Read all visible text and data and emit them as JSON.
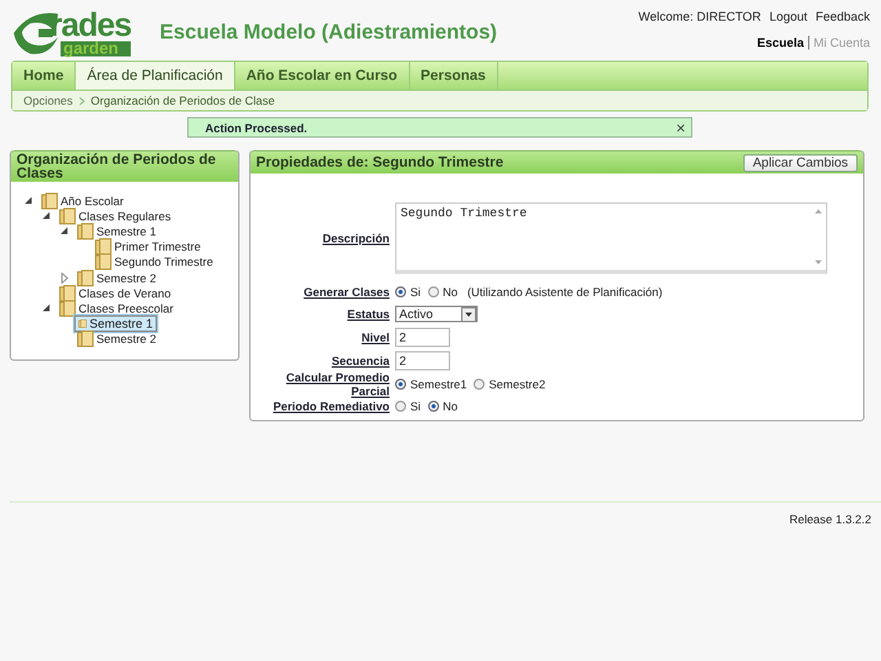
{
  "logo": {
    "word": "rades",
    "sub": "garden"
  },
  "school": "Escuela Modelo (Adiestramientos)",
  "user_links": [
    "Welcome: DIRECTOR",
    "Logout",
    "Feedback"
  ],
  "context_links": [
    {
      "label": "Escuela",
      "selected": true
    },
    {
      "label": "Mi Cuenta",
      "selected": false
    }
  ],
  "tabs": [
    {
      "label": "Home",
      "selected": false
    },
    {
      "label": "Área de Planificación",
      "selected": true
    },
    {
      "label": "Año Escolar en Curso",
      "selected": false
    },
    {
      "label": "Personas",
      "selected": false
    }
  ],
  "breadcrumb": [
    "Opciones",
    "Organización de Periodos de Clase"
  ],
  "message": {
    "text": "Action Processed.",
    "close": "×"
  },
  "tree_panel": {
    "title": "Organización de Periodos de Clases",
    "items": [
      {
        "label": "Año Escolar",
        "expanded": true,
        "selected": false,
        "children": [
          {
            "label": "Clases Regulares",
            "expanded": true,
            "selected": false,
            "children": [
              {
                "label": "Semestre 1",
                "expanded": true,
                "selected": false,
                "children": [
                  {
                    "label": "Primer Trimestre",
                    "selected": false
                  },
                  {
                    "label": "Segundo Trimestre",
                    "selected": false
                  }
                ]
              },
              {
                "label": "Semestre 2",
                "expanded": false,
                "selected": false
              }
            ]
          },
          {
            "label": "Clases de Verano",
            "selected": false
          },
          {
            "label": "Clases Preescolar",
            "expanded": true,
            "selected": false,
            "children": [
              {
                "label": "Semestre 1",
                "selected": true
              },
              {
                "label": "Semestre 2",
                "selected": false
              }
            ]
          }
        ]
      }
    ]
  },
  "properties": {
    "title": "Propiedades de: Segundo Trimestre",
    "apply_button": "Aplicar Cambios",
    "fields": [
      {
        "kind": "textarea",
        "label": "Descripción",
        "value": "Segundo Trimestre"
      },
      {
        "kind": "radio",
        "label": "Generar Clases",
        "options": [
          {
            "label": "Si",
            "selected": true
          },
          {
            "label": "No",
            "selected": false
          }
        ],
        "note": "(Utilizando Asistente de Planificación)"
      },
      {
        "kind": "select",
        "label": "Estatus",
        "value": "Activo"
      },
      {
        "kind": "text",
        "label": "Nivel",
        "value": "2"
      },
      {
        "kind": "text",
        "label": "Secuencia",
        "value": "2"
      },
      {
        "kind": "radio",
        "label": "Calcular Promedio Parcial",
        "options": [
          {
            "label": "Semestre1",
            "selected": true
          },
          {
            "label": "Semestre2",
            "selected": false
          }
        ]
      },
      {
        "kind": "radio",
        "label": "Periodo Remediativo",
        "options": [
          {
            "label": "Si",
            "selected": false
          },
          {
            "label": "No",
            "selected": true
          }
        ]
      }
    ]
  },
  "release": "Release 1.3.2.2"
}
